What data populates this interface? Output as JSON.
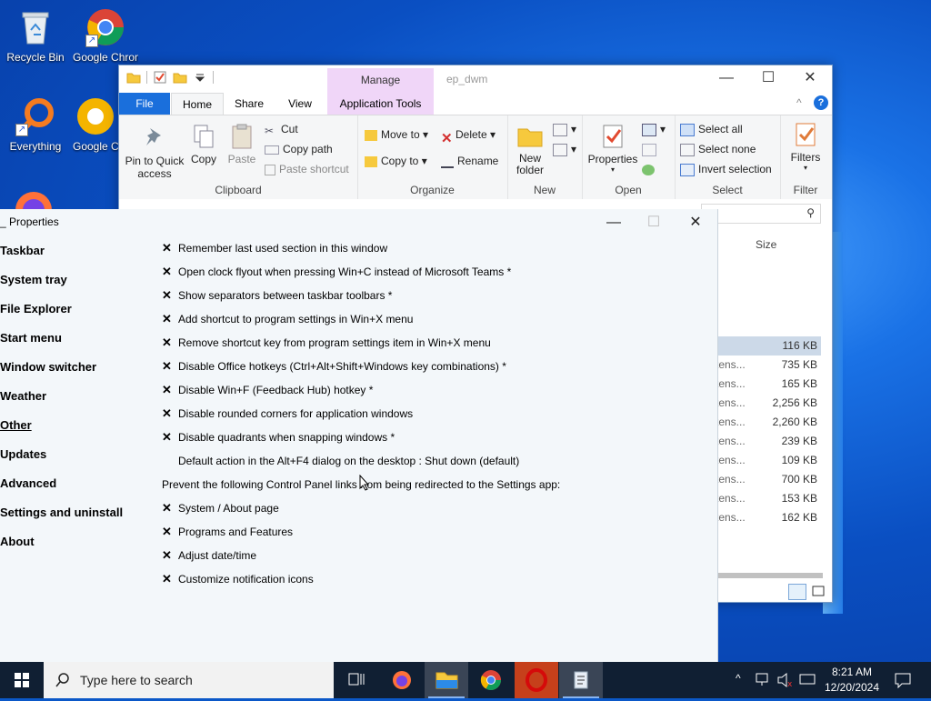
{
  "desktop": {
    "icons": [
      {
        "label": "Recycle Bin",
        "icon": "recycle-bin-icon"
      },
      {
        "label": "Google Chrome",
        "icon": "chrome-icon"
      },
      {
        "label": "Everything",
        "icon": "everything-search-icon"
      },
      {
        "label": "Google Chrome",
        "icon": "chrome-icon"
      }
    ]
  },
  "explorer": {
    "title": "ep_dwm",
    "manage_label": "Manage",
    "tabs": [
      "File",
      "Home",
      "Share",
      "View",
      "Application Tools"
    ],
    "ribbon": {
      "clipboard": {
        "label": "Clipboard",
        "pin": "Pin to Quick access",
        "copy": "Copy",
        "paste": "Paste",
        "cut": "Cut",
        "copy_path": "Copy path",
        "paste_shortcut": "Paste shortcut"
      },
      "organize": {
        "label": "Organize",
        "move_to": "Move to",
        "copy_to": "Copy to",
        "delete": "Delete",
        "rename": "Rename"
      },
      "new": {
        "label": "New",
        "new_folder": "New folder"
      },
      "open": {
        "label": "Open",
        "properties": "Properties"
      },
      "select": {
        "label": "Select",
        "select_all": "Select all",
        "select_none": "Select none",
        "invert": "Invert selection"
      },
      "filter": {
        "label": "Filter",
        "filters": "Filters"
      }
    },
    "column_size": "Size",
    "rows": [
      {
        "type": "",
        "size": "116 KB",
        "selected": true
      },
      {
        "type": "tens...",
        "size": "735 KB"
      },
      {
        "type": "tens...",
        "size": "165 KB"
      },
      {
        "type": "tens...",
        "size": "2,256 KB"
      },
      {
        "type": "tens...",
        "size": "2,260 KB"
      },
      {
        "type": "tens...",
        "size": "239 KB"
      },
      {
        "type": "tens...",
        "size": "109 KB"
      },
      {
        "type": "tens...",
        "size": "700 KB"
      },
      {
        "type": "tens...",
        "size": "153 KB"
      },
      {
        "type": "tens...",
        "size": "162 KB"
      }
    ]
  },
  "properties": {
    "title": "Properties",
    "nav": [
      "Taskbar",
      "System tray",
      "File Explorer",
      "Start menu",
      "Window switcher",
      "Weather",
      "Other",
      "Updates",
      "Advanced",
      "Settings and uninstall",
      "About"
    ],
    "active_nav": "Other",
    "options": [
      {
        "text": "Remember last used section in this window",
        "checked": true
      },
      {
        "text": "Open clock flyout when pressing Win+C instead of Microsoft Teams *",
        "checked": true
      },
      {
        "text": "Show separators between taskbar toolbars *",
        "checked": true
      },
      {
        "text": "Add shortcut to program settings in Win+X menu",
        "checked": true
      },
      {
        "text": "Remove shortcut key from program settings item in Win+X menu",
        "checked": true
      },
      {
        "text": "Disable Office hotkeys (Ctrl+Alt+Shift+Windows key combinations) *",
        "checked": true
      },
      {
        "text": "Disable Win+F (Feedback Hub) hotkey *",
        "checked": true
      },
      {
        "text": "Disable rounded corners for application windows",
        "checked": true
      },
      {
        "text": "Disable quadrants when snapping windows *",
        "checked": true
      },
      {
        "text": "Default action in the Alt+F4 dialog on the desktop : Shut down (default)",
        "checked": null
      },
      {
        "text": "Prevent the following Control Panel links from being redirected to the Settings app:",
        "heading": true
      },
      {
        "text": "System / About page",
        "checked": true
      },
      {
        "text": "Programs and Features",
        "checked": true
      },
      {
        "text": "Adjust date/time",
        "checked": true
      },
      {
        "text": "Customize notification icons",
        "checked": true
      }
    ]
  },
  "taskbar": {
    "search_placeholder": "Type here to search",
    "time": "8:21 AM",
    "date": "12/20/2024"
  }
}
